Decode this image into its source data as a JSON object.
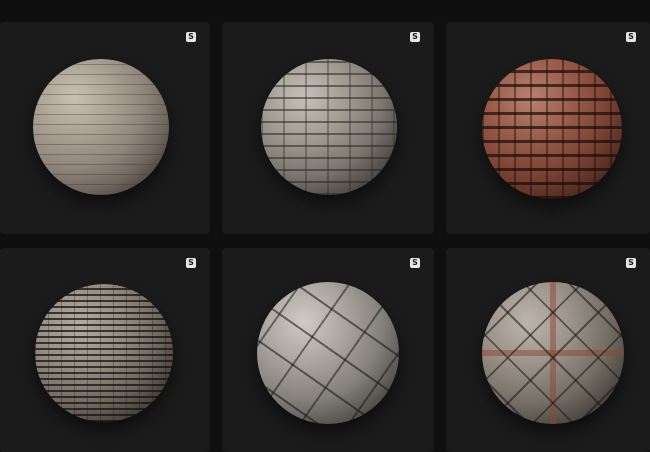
{
  "materials": [
    {
      "badge": "S",
      "icon": "substance-icon"
    },
    {
      "badge": "S",
      "icon": "substance-icon"
    },
    {
      "badge": "S",
      "icon": "substance-icon"
    },
    {
      "badge": "S",
      "icon": "substance-icon"
    },
    {
      "badge": "S",
      "icon": "substance-icon"
    },
    {
      "badge": "S",
      "icon": "substance-icon"
    }
  ],
  "colors": {
    "page_background": "#0f0f10",
    "card_background": "#1b1b1c",
    "badge_background": "#e6e6e6"
  }
}
